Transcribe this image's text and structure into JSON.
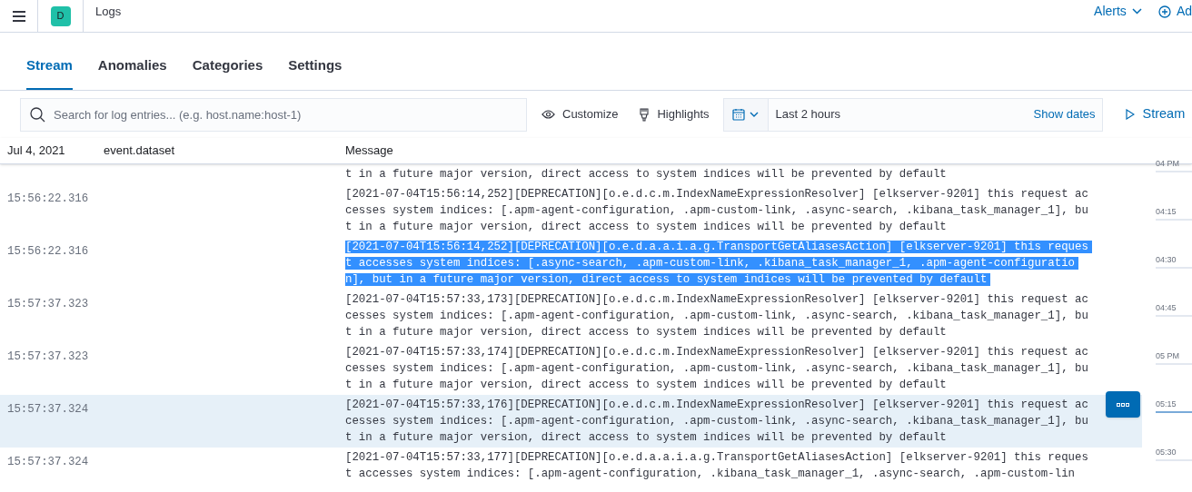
{
  "header": {
    "space_badge": "D",
    "breadcrumb": "Logs",
    "alerts": "Alerts",
    "add": "Ad"
  },
  "tabs": [
    {
      "label": "Stream",
      "selected": true
    },
    {
      "label": "Anomalies",
      "selected": false
    },
    {
      "label": "Categories",
      "selected": false
    },
    {
      "label": "Settings",
      "selected": false
    }
  ],
  "toolbar": {
    "search": {
      "placeholder": "Search for log entries... (e.g. host.name:host-1)"
    },
    "customize": "Customize",
    "highlights": "Highlights",
    "time_range": "Last 2 hours",
    "show_dates": "Show dates",
    "stream": "Stream"
  },
  "table": {
    "columns": [
      "Jul 4, 2021",
      "event.dataset",
      "Message"
    ],
    "rows": [
      {
        "time": "",
        "highlighted": false,
        "text_selected": false,
        "lines": [
          "t in a future major version, direct access to system indices will be prevented by default"
        ]
      },
      {
        "time": "15:56:22.316",
        "highlighted": false,
        "text_selected": false,
        "lines": [
          "[2021-07-04T15:56:14,252][DEPRECATION][o.e.d.c.m.IndexNameExpressionResolver] [elkserver-9201] this request ac",
          "cesses system indices: [.apm-agent-configuration, .apm-custom-link, .async-search, .kibana_task_manager_1], bu",
          "t in a future major version, direct access to system indices will be prevented by default"
        ]
      },
      {
        "time": "15:56:22.316",
        "highlighted": false,
        "text_selected": true,
        "lines": [
          "[2021-07-04T15:56:14,252][DEPRECATION][o.e.d.a.a.i.a.g.TransportGetAliasesAction] [elkserver-9201] this reques",
          "t accesses system indices: [.async-search, .apm-custom-link, .kibana_task_manager_1, .apm-agent-configuratio",
          "n], but in a future major version, direct access to system indices will be prevented by default"
        ]
      },
      {
        "time": "15:57:37.323",
        "highlighted": false,
        "text_selected": false,
        "lines": [
          "[2021-07-04T15:57:33,173][DEPRECATION][o.e.d.c.m.IndexNameExpressionResolver] [elkserver-9201] this request ac",
          "cesses system indices: [.apm-agent-configuration, .apm-custom-link, .async-search, .kibana_task_manager_1], bu",
          "t in a future major version, direct access to system indices will be prevented by default"
        ]
      },
      {
        "time": "15:57:37.323",
        "highlighted": false,
        "text_selected": false,
        "lines": [
          "[2021-07-04T15:57:33,174][DEPRECATION][o.e.d.c.m.IndexNameExpressionResolver] [elkserver-9201] this request ac",
          "cesses system indices: [.apm-agent-configuration, .apm-custom-link, .async-search, .kibana_task_manager_1], bu",
          "t in a future major version, direct access to system indices will be prevented by default"
        ]
      },
      {
        "time": "15:57:37.324",
        "highlighted": true,
        "text_selected": false,
        "lines": [
          "[2021-07-04T15:57:33,176][DEPRECATION][o.e.d.c.m.IndexNameExpressionResolver] [elkserver-9201] this request ac",
          "cesses system indices: [.apm-agent-configuration, .apm-custom-link, .async-search, .kibana_task_manager_1], bu",
          "t in a future major version, direct access to system indices will be prevented by default"
        ]
      },
      {
        "time": "15:57:37.324",
        "highlighted": false,
        "text_selected": false,
        "lines": [
          "[2021-07-04T15:57:33,177][DEPRECATION][o.e.d.a.a.i.a.g.TransportGetAliasesAction] [elkserver-9201] this reques",
          "t accesses system indices: [.apm-agent-configuration, .kibana_task_manager_1, .async-search, .apm-custom-lin"
        ]
      }
    ]
  },
  "timeline": [
    {
      "label": "04 PM",
      "highlighted": false
    },
    {
      "label": "04:15",
      "highlighted": false
    },
    {
      "label": "04:30",
      "highlighted": false
    },
    {
      "label": "04:45",
      "highlighted": false
    },
    {
      "label": "05 PM",
      "highlighted": false
    },
    {
      "label": "05:15",
      "highlighted": true
    },
    {
      "label": "05:30",
      "highlighted": false
    }
  ]
}
